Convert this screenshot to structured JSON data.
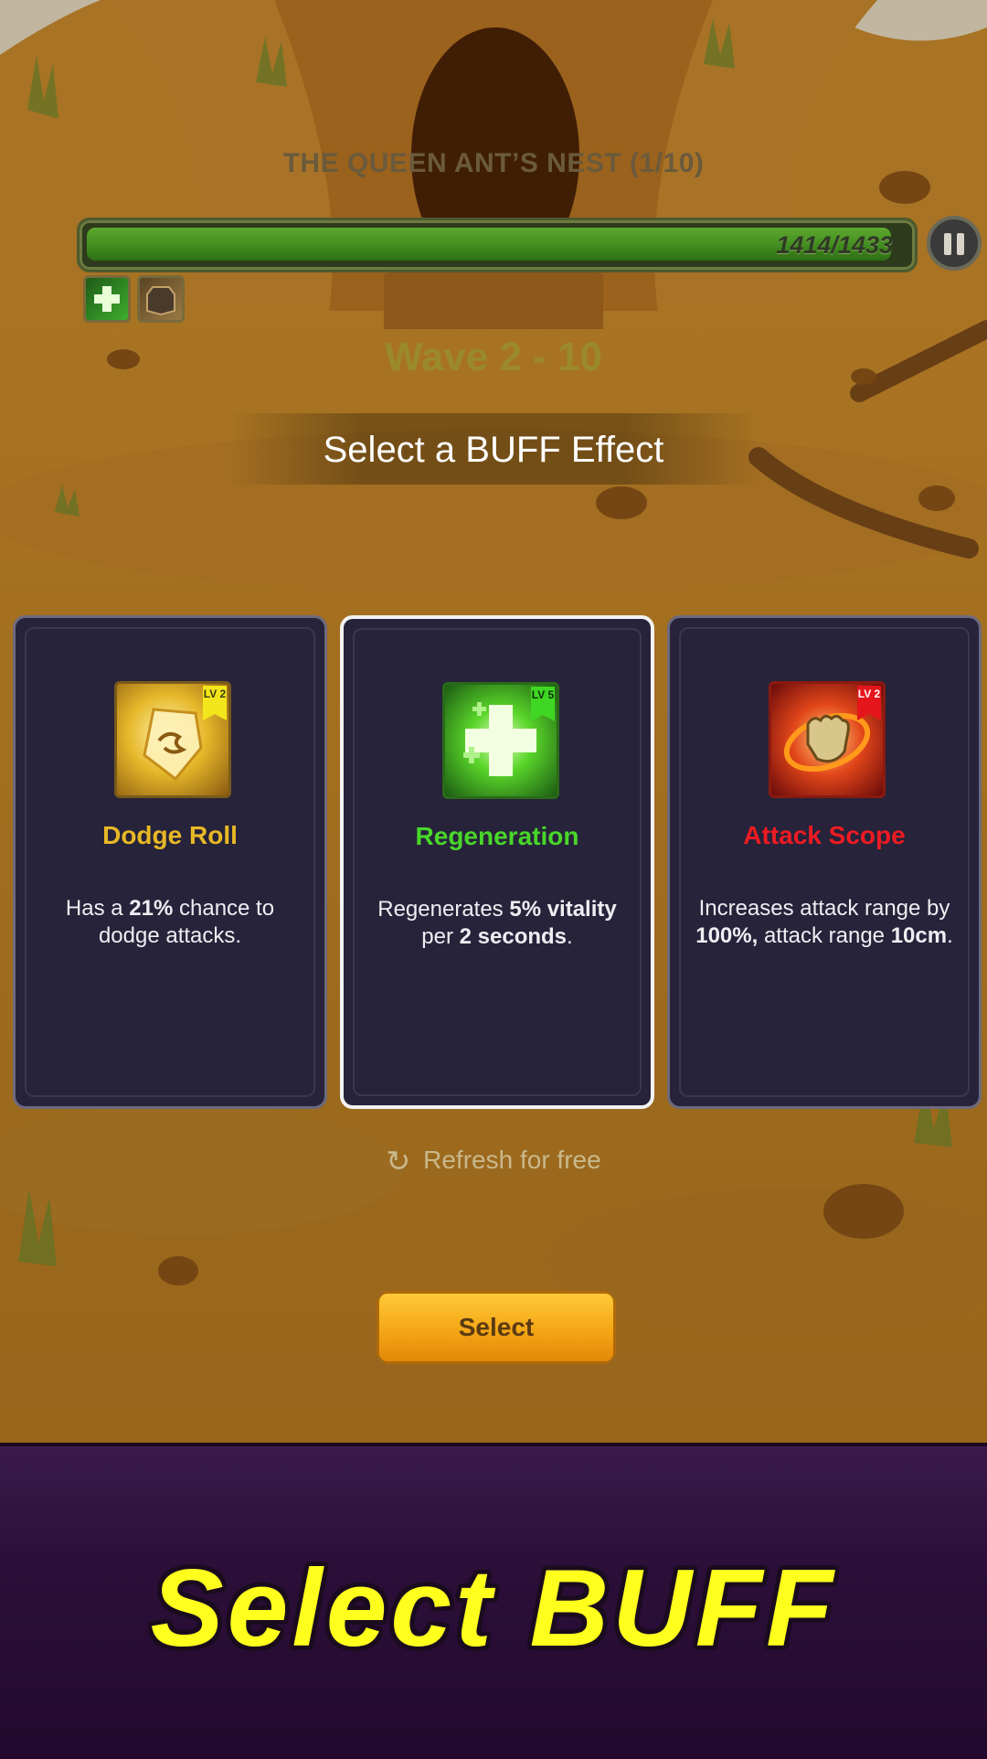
{
  "header": {
    "level_title": "THE QUEEN ANT’S NEST (1/10)",
    "hp_text": "1414/1433",
    "hp_fraction": 0.987,
    "pause_icon": "pause-icon",
    "status_icons": [
      "regeneration-buff-icon",
      "armor-buff-icon"
    ]
  },
  "wave": {
    "title": "Wave 2 - 10"
  },
  "prompt": {
    "heading": "Select a BUFF Effect"
  },
  "cards": [
    {
      "name": "Dodge Roll",
      "name_color": "#e8b825",
      "icon": "dodge-roll-icon",
      "level": "LV 2",
      "lv_color": "#f4e61c",
      "desc": {
        "p1": "Has a ",
        "b1": "21%",
        "p2": " chance to dodge attacks."
      }
    },
    {
      "name": "Regeneration",
      "name_color": "#49d62a",
      "icon": "regeneration-icon",
      "level": "LV 5",
      "lv_color": "#3fd624",
      "selected": true,
      "desc": {
        "p1": "Regenerates ",
        "b1": "5% vitality",
        "p2": " per ",
        "b2": "2 seconds",
        "p3": "."
      }
    },
    {
      "name": "Attack Scope",
      "name_color": "#ee1b22",
      "icon": "attack-scope-icon",
      "level": "LV 2",
      "lv_color": "#e4161c",
      "desc": {
        "p1": "Increases attack range by ",
        "b1": "100%,",
        "p2": " attack range ",
        "b2": "10cm",
        "p3": "."
      }
    }
  ],
  "refresh": {
    "label": "Refresh for free",
    "icon": "refresh-icon"
  },
  "actions": {
    "select_label": "Select"
  },
  "footer": {
    "title": "Select BUFF"
  }
}
